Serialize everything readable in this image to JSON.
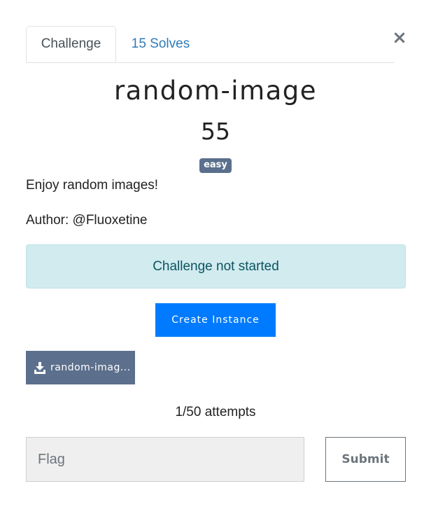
{
  "tabs": [
    {
      "label": "Challenge",
      "active": true
    },
    {
      "label": "15 Solves",
      "active": false
    }
  ],
  "close": {
    "glyph": "×",
    "icon": "close-icon"
  },
  "challenge": {
    "name": "random-image",
    "points": "55",
    "difficulty": "easy",
    "description": "Enjoy random images!",
    "author": "Author: @Fluoxetine"
  },
  "status": {
    "text": "Challenge not started"
  },
  "actions": {
    "create_instance": "Create Instance"
  },
  "file": {
    "label": "random-imag...",
    "icon": "download-icon"
  },
  "attempts": "1/50 attempts",
  "flag": {
    "placeholder": "Flag",
    "value": ""
  },
  "submit": {
    "label": "Submit"
  },
  "colors": {
    "link": "#2f7bb8",
    "badge": "#5b6f8d",
    "alert_bg": "#d1ebef",
    "alert_text": "#0c5460",
    "primary": "#007bff",
    "file_button": "#5c6f8c"
  }
}
